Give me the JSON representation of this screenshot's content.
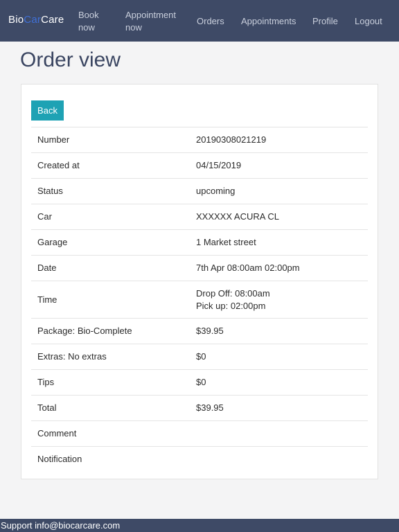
{
  "navbar": {
    "brand_part1": "Bio",
    "brand_part2": "Car",
    "brand_part3": "Care",
    "items": [
      {
        "label": "Book now"
      },
      {
        "label": "Appointment now"
      },
      {
        "label": "Orders"
      },
      {
        "label": "Appointments"
      },
      {
        "label": "Profile"
      },
      {
        "label": "Logout"
      }
    ]
  },
  "page": {
    "title": "Order view",
    "back_label": "Back"
  },
  "details": {
    "rows": [
      {
        "label": "Number",
        "value": "20190308021219"
      },
      {
        "label": "Created at",
        "value": "04/15/2019"
      },
      {
        "label": "Status",
        "value": "upcoming"
      },
      {
        "label": "Car",
        "value": "XXXXXX ACURA CL"
      },
      {
        "label": "Garage",
        "value": "1 Market street"
      },
      {
        "label": "Date",
        "value": "7th Apr 08:00am 02:00pm"
      },
      {
        "label": "Time",
        "value_line1": "Drop Off: 08:00am",
        "value_line2": "Pick up: 02:00pm"
      },
      {
        "label": "Package: Bio-Complete",
        "value": "$39.95"
      },
      {
        "label": "Extras: No extras",
        "value": "$0"
      },
      {
        "label": "Tips",
        "value": "$0"
      },
      {
        "label": "Total",
        "value": "$39.95"
      },
      {
        "label": "Comment",
        "value": ""
      },
      {
        "label": "Notification",
        "value": ""
      }
    ]
  },
  "footer": {
    "text": "Support info@biocarcare.com"
  },
  "colors": {
    "navbar_bg": "#3e4a66",
    "brand_accent": "#3f6fd6",
    "button_bg": "#1ea2b4",
    "title_color": "#3a4561"
  }
}
